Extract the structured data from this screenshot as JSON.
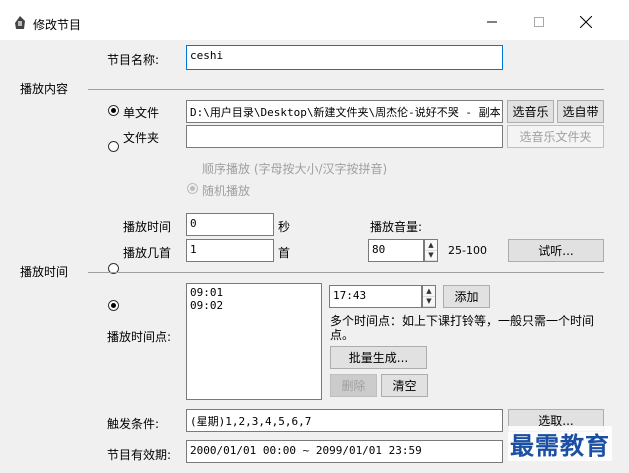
{
  "window": {
    "title": "修改节目",
    "icon": "app-icon"
  },
  "program_name": {
    "label": "节目名称:",
    "value": "ceshi"
  },
  "sections": {
    "play_content": "播放内容",
    "play_time": "播放时间"
  },
  "source": {
    "single_file_label": "单文件",
    "single_file_checked": true,
    "single_file_path": "D:\\用户目录\\Desktop\\新建文件夹\\周杰伦-说好不哭 - 副本",
    "select_music_button": "选音乐",
    "select_builtin_button": "选自带",
    "folder_label": "文件夹",
    "folder_checked": false,
    "folder_path": "",
    "select_music_folder_button": "选音乐文件夹",
    "sequential_play_label": "顺序播放 (字母按大小/汉字按拼音)",
    "random_play_label": "随机播放"
  },
  "play_mode": {
    "play_time_label": "播放时间",
    "play_time_value": "0",
    "play_time_unit": "秒",
    "play_count_label": "播放几首",
    "play_count_value": "1",
    "play_count_unit": "首",
    "play_count_checked": true,
    "volume_label": "播放音量:",
    "volume_value": "80",
    "volume_range": "25-100",
    "preview_button": "试听..."
  },
  "time_points": {
    "label": "播放时间点:",
    "items": [
      "09:01",
      "09:02"
    ],
    "time_input": "17:43",
    "add_button": "添加",
    "hint": "多个时间点：如上下课打铃等，一般只需一个时间点。",
    "batch_button": "批量生成...",
    "delete_button": "删除",
    "clear_button": "清空"
  },
  "trigger": {
    "label": "触发条件:",
    "value": "(星期)1,2,3,4,5,6,7",
    "select_button": "选取..."
  },
  "validity": {
    "label": "节目有效期:",
    "value": "2000/01/01 00:00 ~ 2099/01/01 23:59"
  },
  "watermark": "最需教育"
}
